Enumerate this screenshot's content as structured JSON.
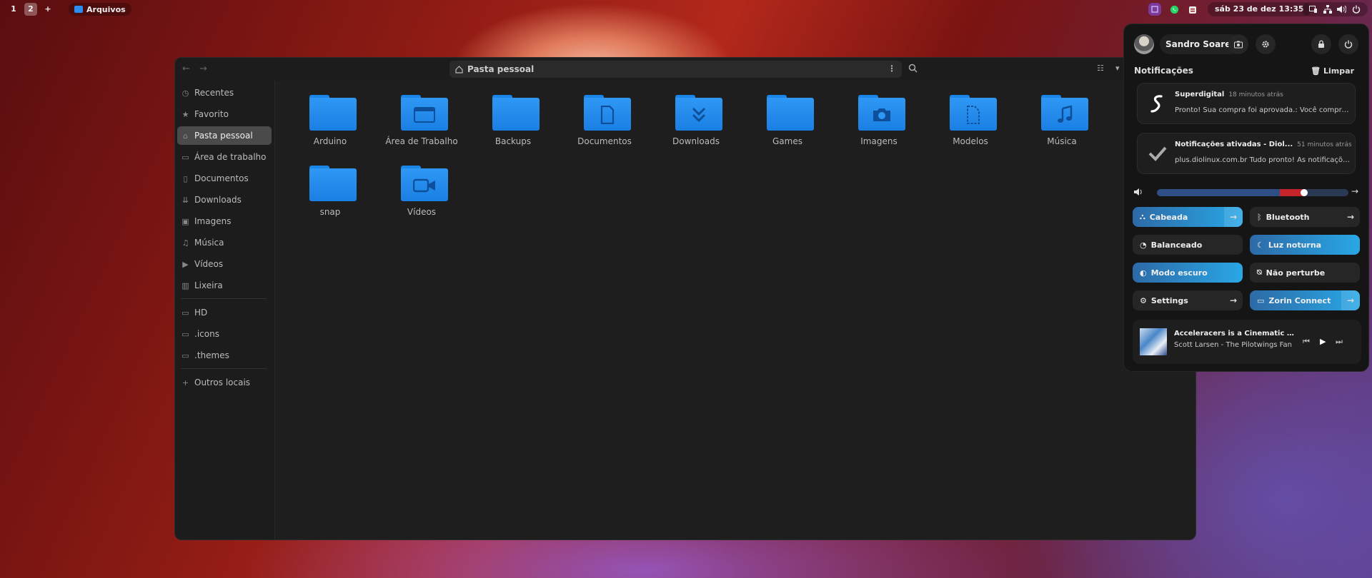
{
  "topbar": {
    "workspaces": [
      "1",
      "2",
      "+"
    ],
    "active_app": "Arquivos",
    "clock": "sáb 23 de dez  13:35"
  },
  "window": {
    "path": "Pasta pessoal",
    "sidebar": {
      "places": [
        "Recentes",
        "Favorito",
        "Pasta pessoal",
        "Área de trabalho",
        "Documentos",
        "Downloads",
        "Imagens",
        "Música",
        "Vídeos",
        "Lixeira"
      ],
      "devices": [
        "HD",
        ".icons",
        ".themes"
      ],
      "other": "Outros locais"
    },
    "folders": [
      "Arduino",
      "Área de Trabalho",
      "Backups",
      "Documentos",
      "Downloads",
      "Games",
      "Imagens",
      "Modelos",
      "Música",
      "snap",
      "Vídeos"
    ]
  },
  "panel": {
    "user": "Sandro Soares",
    "notifications_title": "Notificações",
    "clear_label": "Limpar",
    "notifications": [
      {
        "app": "Superdigital",
        "time": "18 minutos atrás",
        "body": "Pronto! Sua compra foi aprovada.: Você comprou ..."
      },
      {
        "app": "Notificações ativadas - Diol...",
        "time": "51 minutos atrás",
        "body": "plus.diolinux.com.br  Tudo pronto! As notificações..."
      }
    ],
    "volume_level": 0.77,
    "toggles": {
      "wired": "Cabeada",
      "bluetooth": "Bluetooth",
      "power": "Balanceado",
      "night": "Luz noturna",
      "dark": "Modo escuro",
      "dnd": "Não perturbe",
      "settings": "Settings",
      "connect": "Zorin Connect"
    },
    "media": {
      "title": "Acceleracers is a Cinematic Mas...",
      "artist": "Scott Larsen - The Pilotwings Fan"
    }
  },
  "colors": {
    "accent": "#2d8cf0",
    "volume_over": "#c4242a"
  }
}
